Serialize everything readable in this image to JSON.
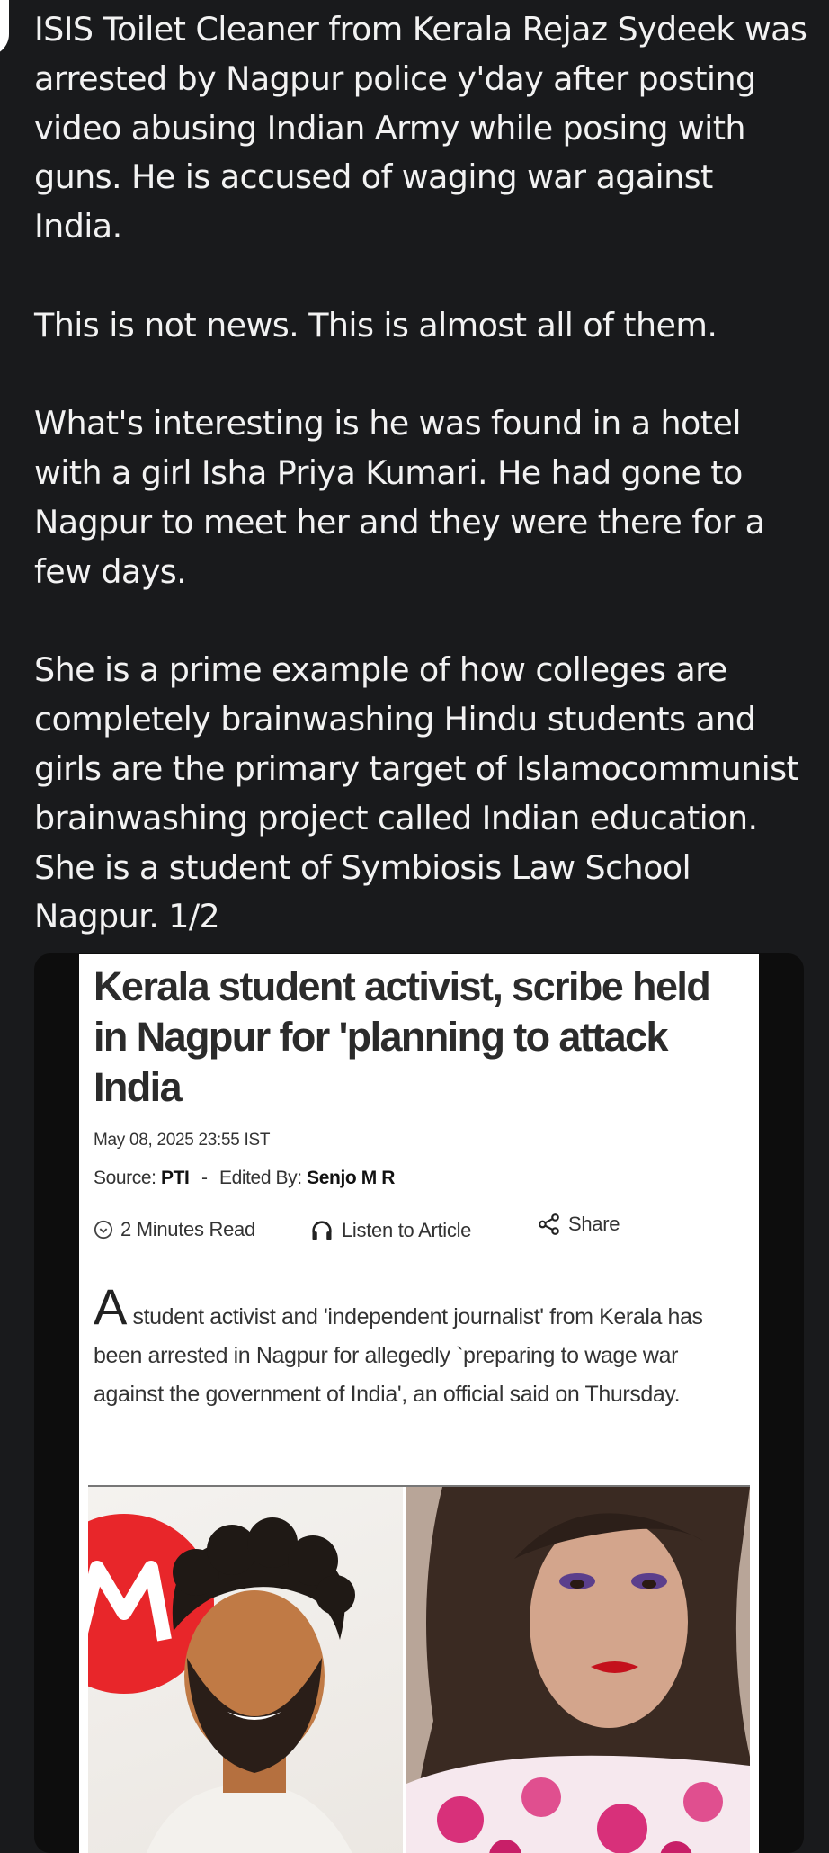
{
  "post": {
    "paragraphs": [
      "ISIS Toilet Cleaner from Kerala Rejaz Sydeek was arrested by Nagpur police y'day after posting video abusing Indian Army while posing with guns. He is accused of waging war against India.",
      "This is not news. This is almost all of them.",
      "What's interesting is he was found in a hotel with a girl Isha Priya Kumari. He had gone to Nagpur to meet her and they were  there for a few days.",
      "She is a prime example of how colleges are completely brainwashing Hindu students and girls are the primary target of Islamocommunist brainwashing project called Indian education. She is a student of Symbiosis Law School Nagpur. 1/2"
    ]
  },
  "article": {
    "headline": "Kerala student activist, scribe held in Nagpur for 'planning to attack India",
    "date": "May 08, 2025 23:55 IST",
    "source_label": "Source:",
    "source_value": "PTI",
    "separator": "-",
    "edited_label": "Edited By:",
    "edited_value": "Senjo M R",
    "read_time": "2 Minutes Read",
    "listen_label": "Listen to Article",
    "share_label": "Share",
    "dropcap": "A",
    "body": " student activist and 'independent journalist' from Kerala has been arrested in Nagpur for allegedly `preparing to wage war against the government of India', an official said on Thursday.",
    "icons": [
      "clock-icon",
      "headphones-icon",
      "share-icon"
    ]
  },
  "colors": {
    "page_background": "#191a1c",
    "text": "#f2f2f2",
    "card_background": "#0d0d0d",
    "article_background": "#ffffff",
    "logo_red": "#e8262a"
  }
}
